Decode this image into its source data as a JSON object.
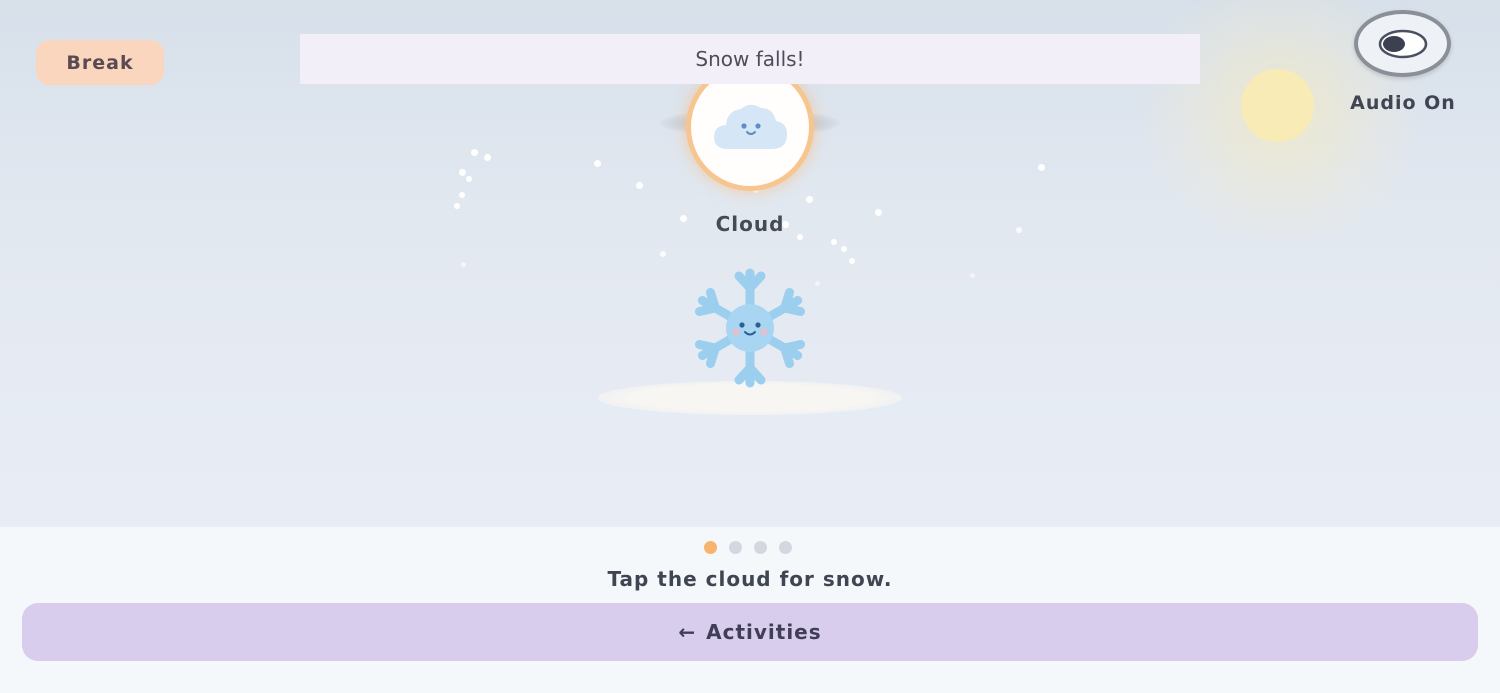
{
  "header": {
    "break_label": "Break",
    "banner_text": "Snow falls!",
    "audio_label": "Audio On"
  },
  "scene": {
    "cloud_label": "Cloud"
  },
  "footer": {
    "pager": {
      "total": 4,
      "current": 1
    },
    "instruction": "Tap the cloud for snow.",
    "activities_label": "Activities",
    "activities_arrow": "←"
  },
  "colors": {
    "break_button": "#fbd6be",
    "activities_button": "#d8cdec",
    "active_dot": "#f6b46c",
    "inactive_dot": "#d3d7df",
    "snowflake": "#9ccfee",
    "cloud_ring": "#f7c690"
  },
  "icons": {
    "audio": "eye-toggle-icon",
    "cloud": "cloud-face-icon",
    "character": "snowflake-face-icon",
    "back": "left-arrow-icon"
  }
}
